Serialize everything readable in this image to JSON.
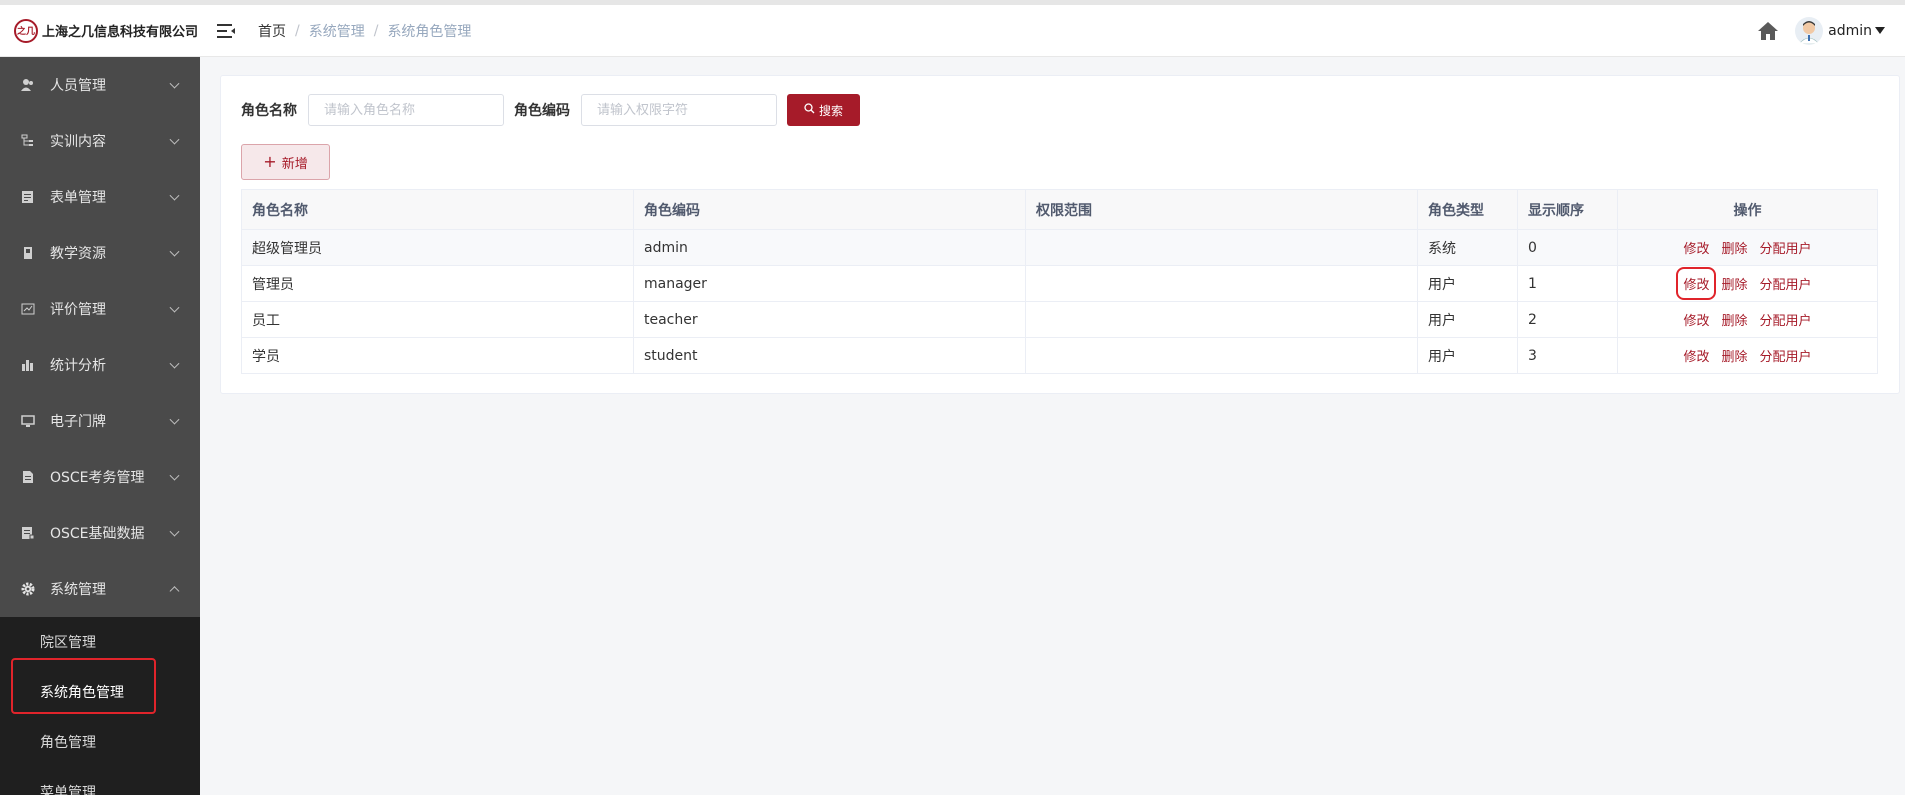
{
  "brand": {
    "logo_mark": "之几",
    "name": "上海之几信息科技有限公司",
    "accent": "#a61b29"
  },
  "breadcrumb": [
    "首页",
    "系统管理",
    "系统角色管理"
  ],
  "user": {
    "name": "admin"
  },
  "sidebar": {
    "items": [
      {
        "label": "人员管理",
        "icon": "users-icon"
      },
      {
        "label": "实训内容",
        "icon": "tree-icon"
      },
      {
        "label": "表单管理",
        "icon": "form-icon"
      },
      {
        "label": "教学资源",
        "icon": "book-icon"
      },
      {
        "label": "评价管理",
        "icon": "chart-box-icon"
      },
      {
        "label": "统计分析",
        "icon": "bar-chart-icon"
      },
      {
        "label": "电子门牌",
        "icon": "monitor-icon"
      },
      {
        "label": "OSCE考务管理",
        "icon": "document-icon"
      },
      {
        "label": "OSCE基础数据",
        "icon": "database-icon"
      },
      {
        "label": "系统管理",
        "icon": "gear-icon"
      }
    ],
    "subitems": [
      "院区管理",
      "系统角色管理",
      "角色管理",
      "菜单管理"
    ]
  },
  "search": {
    "role_name_label": "角色名称",
    "role_name_placeholder": "请输入角色名称",
    "role_code_label": "角色编码",
    "role_code_placeholder": "请输入权限字符",
    "search_button": "搜索"
  },
  "toolbar": {
    "add_button": "新增"
  },
  "table": {
    "headers": [
      "角色名称",
      "角色编码",
      "权限范围",
      "角色类型",
      "显示顺序",
      "操作"
    ],
    "rows": [
      {
        "name": "超级管理员",
        "code": "admin",
        "scope": "",
        "type": "系统",
        "order": "0"
      },
      {
        "name": "管理员",
        "code": "manager",
        "scope": "",
        "type": "用户",
        "order": "1"
      },
      {
        "name": "员工",
        "code": "teacher",
        "scope": "",
        "type": "用户",
        "order": "2"
      },
      {
        "name": "学员",
        "code": "student",
        "scope": "",
        "type": "用户",
        "order": "3"
      }
    ],
    "actions": [
      "修改",
      "删除",
      "分配用户"
    ]
  }
}
